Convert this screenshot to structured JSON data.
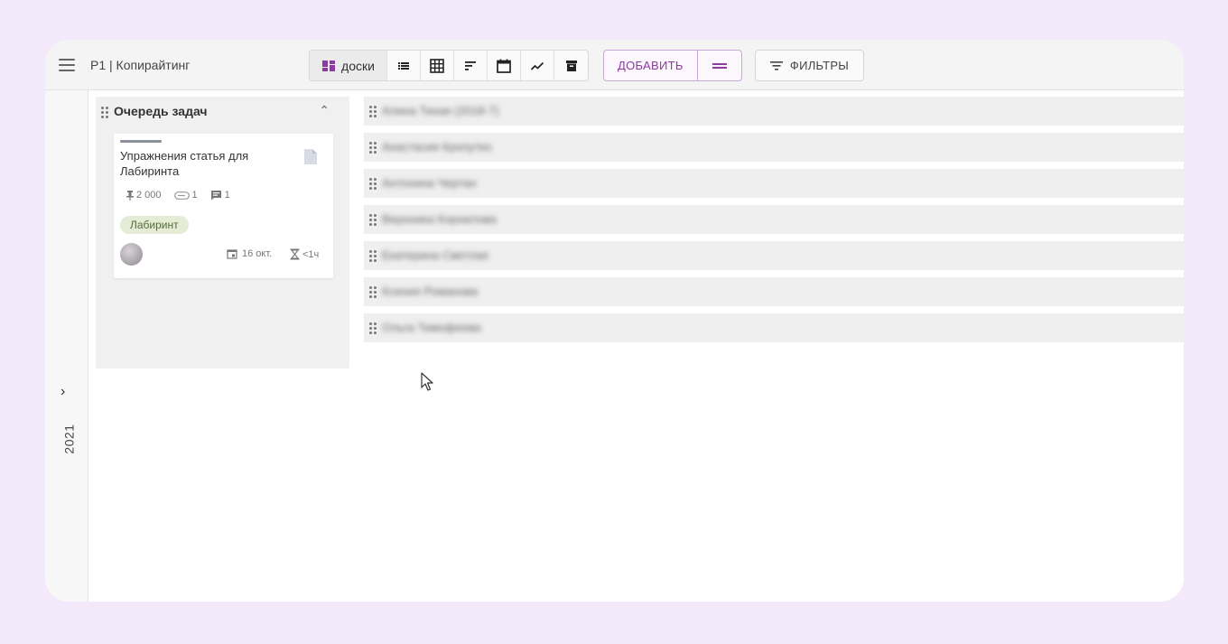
{
  "header": {
    "title": "Р1 | Копирайтинг",
    "views": [
      {
        "icon": "boards-icon",
        "label": "доски",
        "active": true
      },
      {
        "icon": "list-icon"
      },
      {
        "icon": "grid-icon"
      },
      {
        "icon": "sort-icon"
      },
      {
        "icon": "calendar-icon"
      },
      {
        "icon": "chart-icon"
      },
      {
        "icon": "archive-icon"
      }
    ],
    "add_label": "ДОБАВИТЬ",
    "filters_label": "ФИЛЬТРЫ"
  },
  "sidebar": {
    "year": "2021"
  },
  "column": {
    "title": "Очередь задач",
    "card": {
      "title": "Упражнения статья для Лабиринта",
      "chars": "2 000",
      "attachments": "1",
      "comments": "1",
      "tag": "Лабиринт",
      "due": "16 окт.",
      "estimate": "<1ч"
    }
  },
  "lanes": [
    {
      "name": "Алина Тихая (2018-7)"
    },
    {
      "name": "Анастасия Кропутко"
    },
    {
      "name": "Антонина Чертан"
    },
    {
      "name": "Вероника Корнилова"
    },
    {
      "name": "Екатерина Светлая"
    },
    {
      "name": "Ксения Романова"
    },
    {
      "name": "Ольга Тимофеева"
    }
  ],
  "colors": {
    "background": "#f4e9fb",
    "accent": "#8c3b9e",
    "tag_bg": "#e4ecd6"
  }
}
